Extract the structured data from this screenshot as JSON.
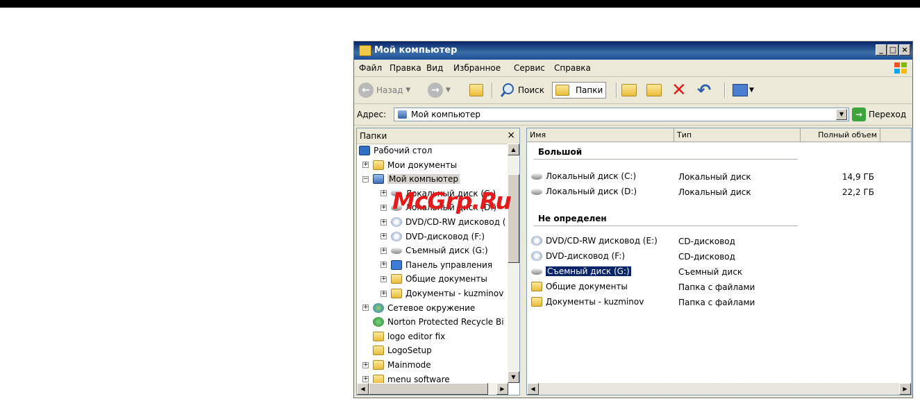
{
  "window": {
    "title": "Мой компьютер",
    "controls": [
      "_",
      "□",
      "×"
    ]
  },
  "menu": [
    "Файл",
    "Правка",
    "Вид",
    "Избранное",
    "Сервис",
    "Справка"
  ],
  "toolbar": {
    "back": "Назад",
    "search": "Поиск",
    "folders": "Папки"
  },
  "address": {
    "label": "Адрес:",
    "value": "Мой компьютер",
    "go": "Переход"
  },
  "folders_pane": {
    "title": "Папки",
    "close": "×",
    "items": [
      {
        "label": "Рабочий стол",
        "icon": "desktop-icon",
        "expander": ""
      },
      {
        "label": "Мои документы",
        "icon": "folder-icon",
        "expander": "+"
      },
      {
        "label": "Мой компьютер",
        "icon": "computer-icon",
        "expander": "−"
      },
      {
        "label": "Локальный диск (C:)",
        "icon": "disk-icon",
        "expander": "+"
      },
      {
        "label": "Локальный диск (D:)",
        "icon": "disk-icon",
        "expander": "+"
      },
      {
        "label": "DVD/CD-RW дисковод (",
        "icon": "cd-icon",
        "expander": "+"
      },
      {
        "label": "DVD-дисковод (F:)",
        "icon": "cd-icon",
        "expander": "+"
      },
      {
        "label": "Съемный диск (G:)",
        "icon": "disk-icon",
        "expander": "+"
      },
      {
        "label": "Панель управления",
        "icon": "control-panel-icon",
        "expander": "+"
      },
      {
        "label": "Общие документы",
        "icon": "folder-icon",
        "expander": "+"
      },
      {
        "label": "Документы - kuzminov",
        "icon": "folder-icon",
        "expander": "+"
      },
      {
        "label": "Сетевое окружение",
        "icon": "network-icon",
        "expander": "+"
      },
      {
        "label": "Norton Protected Recycle Bi",
        "icon": "recycle-icon",
        "expander": ""
      },
      {
        "label": "logo editor fix",
        "icon": "folder-icon",
        "expander": ""
      },
      {
        "label": "LogoSetup",
        "icon": "folder-icon",
        "expander": ""
      },
      {
        "label": "Mainmode",
        "icon": "folder-icon",
        "expander": "+"
      },
      {
        "label": "menu software",
        "icon": "folder-icon",
        "expander": "+"
      }
    ]
  },
  "list": {
    "columns": [
      "Имя",
      "Тип",
      "Полный объем"
    ],
    "groups": [
      {
        "title": "Большой",
        "rows": [
          {
            "name": "Локальный диск (C:)",
            "type": "Локальный диск",
            "size": "14,9 ГБ",
            "icon": "disk-icon"
          },
          {
            "name": "Локальный диск (D:)",
            "type": "Локальный диск",
            "size": "22,2 ГБ",
            "icon": "disk-icon"
          }
        ]
      },
      {
        "title": "Не определен",
        "rows": [
          {
            "name": "DVD/CD-RW дисковод (E:)",
            "type": "CD-дисковод",
            "size": "",
            "icon": "cd-icon"
          },
          {
            "name": "DVD-дисковод (F:)",
            "type": "CD-дисковод",
            "size": "",
            "icon": "cd-icon"
          },
          {
            "name": "Съемный диск (G:)",
            "type": "Съемный диск",
            "size": "",
            "icon": "disk-icon"
          },
          {
            "name": "Общие документы",
            "type": "Папка с файлами",
            "size": "",
            "icon": "folder-icon"
          },
          {
            "name": "Документы - kuzminov",
            "type": "Папка с файлами",
            "size": "",
            "icon": "folder-icon"
          }
        ]
      }
    ]
  },
  "watermark": "McGrp.Ru",
  "colors": {
    "titlebar": "#0a246a",
    "selection": "#0a246a",
    "chrome": "#ece9d8",
    "watermark": "#e51a1a"
  }
}
